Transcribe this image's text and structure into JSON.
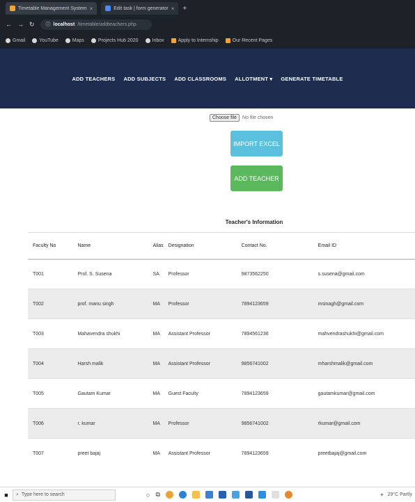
{
  "browser": {
    "tabs": [
      {
        "label": "Timetable Management System"
      },
      {
        "label": "Edit task | form generator"
      }
    ],
    "new_tab_symbol": "+",
    "url": {
      "host": "localhost",
      "path": "/timetable/addteachers.php"
    },
    "bookmarks": [
      "Gmail",
      "YouTube",
      "Maps",
      "Projects Hub 2020",
      "Inbox",
      "Apply to Internship",
      "Our Recent Pages"
    ]
  },
  "nav": {
    "items": [
      "ADD TEACHERS",
      "ADD SUBJECTS",
      "ADD CLASSROOMS",
      "ALLOTMENT ▾",
      "GENERATE TIMETABLE"
    ]
  },
  "file_input": {
    "button_label": "Choose file",
    "status": "No file chosen"
  },
  "buttons": {
    "import": "IMPORT EXCEL",
    "add": "ADD TEACHER"
  },
  "table": {
    "title": "Teacher's Information",
    "headers": [
      "Faculty No",
      "Name",
      "Alias",
      "Designation",
      "Contact No.",
      "Email ID"
    ],
    "rows": [
      [
        "T001",
        "Prof. S. Susena",
        "SA",
        "Professor",
        "9873562250",
        "s.susena@gmail.com"
      ],
      [
        "T002",
        "prof. manu singh",
        "MA",
        "Professor",
        "7894123659",
        "msinagh@gmail.com"
      ],
      [
        "T003",
        "Mahavendra shukhi",
        "MA",
        "Assistant Professor",
        "7894561236",
        "mahvendrashukhi@gmail.com"
      ],
      [
        "T004",
        "Harsh malik",
        "MA",
        "Assistant Professor",
        "9856741002",
        "mharshmalik@gmail.com"
      ],
      [
        "T005",
        "Gautam Kumar",
        "MA",
        "Guest Faculty",
        "7894123659",
        "gautamkumar@gmail.com"
      ],
      [
        "T006",
        "r. kumar",
        "MA",
        "Professor",
        "9856741002",
        "rkumar@gmail.com"
      ],
      [
        "T007",
        "preet bajaj",
        "MA",
        "Assistant Professor",
        "7894123659",
        "preetbajaj@gmail.com"
      ]
    ]
  },
  "taskbar": {
    "search_placeholder": "Type here to search",
    "tray_text": "29°C Partly"
  },
  "colors": {
    "navbar": "#1d2c4f",
    "import_button": "#5bc0de",
    "add_button": "#5cb85c"
  }
}
